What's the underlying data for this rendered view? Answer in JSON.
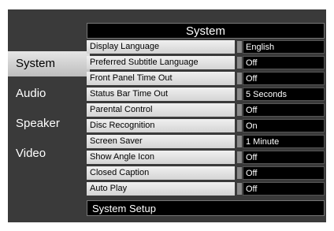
{
  "panel_title": "System",
  "footer_text": "System Setup",
  "tabs": [
    {
      "label": "System"
    },
    {
      "label": "Audio"
    },
    {
      "label": "Speaker"
    },
    {
      "label": "Video"
    }
  ],
  "settings": [
    {
      "label": "Display Language",
      "value": "English"
    },
    {
      "label": "Preferred Subtitle Language",
      "value": "Off"
    },
    {
      "label": "Front Panel Time Out",
      "value": "Off"
    },
    {
      "label": "Status Bar Time Out",
      "value": "5 Seconds"
    },
    {
      "label": "Parental Control",
      "value": "Off"
    },
    {
      "label": "Disc Recognition",
      "value": "On"
    },
    {
      "label": "Screen Saver",
      "value": "1 Minute"
    },
    {
      "label": "Show Angle Icon",
      "value": "Off"
    },
    {
      "label": "Closed Caption",
      "value": "Off"
    },
    {
      "label": "Auto Play",
      "value": "Off"
    }
  ]
}
